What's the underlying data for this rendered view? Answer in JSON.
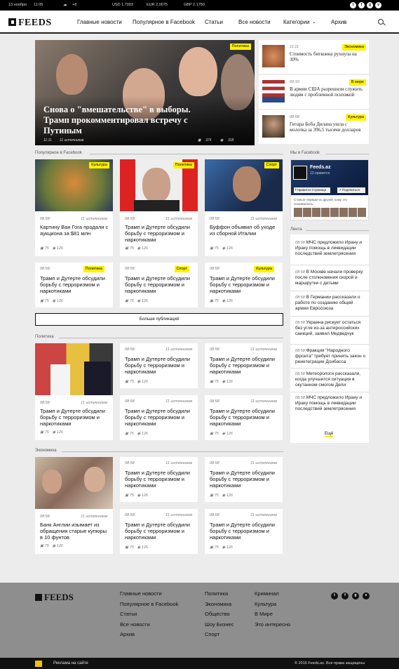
{
  "topbar": {
    "date": "13 ноября",
    "time": "11:05",
    "weather": "+8",
    "usd": "USD 1.7003",
    "eur": "EUR 2.0075",
    "gbp": "GBP 2.1750"
  },
  "social": [
    "twitter",
    "facebook",
    "google-plus",
    "vk"
  ],
  "logo": "FEEDS",
  "nav": [
    "Главные новости",
    "Популярное в Facebook",
    "Статьи",
    "Все новости",
    "Категории",
    "Архив"
  ],
  "hero": {
    "tag": "Политика",
    "title": "Снова о \"вмешательстве\" в выборы. Трамп прокомментировал встречу с Путиным",
    "time": "11:11",
    "sources": "11 источников",
    "comments": "374",
    "views": "318"
  },
  "side": [
    {
      "time": "11:11",
      "tag": "Экономика",
      "text": "Стоимость биткоина рухнула на 30%"
    },
    {
      "time": "09:10",
      "tag": "В мире",
      "text": "В армии США разрешили служить людям с проблемной психикой"
    },
    {
      "time": "08:58",
      "tag": "Культура",
      "text": "Гитара Боба Дилана ушла с молотка за 396,5 тысячи долларов"
    }
  ],
  "sections": {
    "popular": "Популярное в Facebook",
    "fb": "Мы в Facebook",
    "lenta": "Лента",
    "politics": "Политика",
    "economy": "Экономика"
  },
  "popular": [
    {
      "time": "08:58",
      "src": "11 источников",
      "tag": "Культура",
      "title": "Картину Ван Гога продали с аукциона за $81 млн",
      "c": "75",
      "v": "126"
    },
    {
      "time": "08:58",
      "src": "11 источников",
      "tag": "Политика",
      "title": "Трамп и Дутерте обсудили борьбу с терроризмом и наркотиками",
      "c": "75",
      "v": "126"
    },
    {
      "time": "08:58",
      "src": "11 источников",
      "tag": "Спорт",
      "title": "Буффон объявил об уходе из сборной Италии",
      "c": "75",
      "v": "126"
    },
    {
      "time": "08:58",
      "src": "",
      "tag": "Политика",
      "title": "Трамп и Дутерте обсудили борьбу с терроризмом и наркотиками",
      "c": "75",
      "v": "126"
    },
    {
      "time": "08:58",
      "src": "",
      "tag": "Спорт",
      "title": "Трамп и Дутерте обсудили борьбу с терроризмом и наркотиками",
      "c": "75",
      "v": "126"
    },
    {
      "time": "08:58",
      "src": "",
      "tag": "Культура",
      "title": "Трамп и Дутерте обсудили борьбу с терроризмом и наркотиками",
      "c": "75",
      "v": "126"
    }
  ],
  "more_label": "Больше публикаций",
  "politics": [
    {
      "time": "08:58",
      "src": "11 источников",
      "title": "Трамп и Дутерте обсудили борьбу с терроризмом и наркотиками",
      "c": "75",
      "v": "126"
    },
    {
      "time": "08:58",
      "src": "11 источников",
      "title": "Трамп и Дутерте обсудили борьбу с терроризмом и наркотиками",
      "c": "75",
      "v": "126"
    },
    {
      "time": "08:58",
      "src": "11 источников",
      "title": "Трамп и Дутерте обсудили борьбу с терроризмом и наркотиками",
      "c": "75",
      "v": "126"
    },
    {
      "time": "08:58",
      "src": "11 источников",
      "title": "Трамп и Дутерте обсудили борьбу с терроризмом и наркотиками",
      "c": "75",
      "v": "126"
    },
    {
      "time": "08:58",
      "src": "11 источников",
      "title": "Трамп и Дутерте обсудили борьбу с терроризмом и наркотиками",
      "c": "75",
      "v": "126"
    }
  ],
  "economy": [
    {
      "time": "08:58",
      "src": "11 источников",
      "title": "Банк Англии изымает из обращения старые купюры в 10 фунтов",
      "c": "75",
      "v": "126"
    },
    {
      "time": "08:58",
      "src": "11 источников",
      "title": "Трамп и Дутерте обсудили борьбу с терроризмом и наркотиками",
      "c": "75",
      "v": "126"
    },
    {
      "time": "08:58",
      "src": "11 источников",
      "title": "Трамп и Дутерте обсудили борьбу с терроризмом и наркотиками",
      "c": "75",
      "v": "126"
    },
    {
      "time": "08:58",
      "src": "11 источников",
      "title": "Трамп и Дутерте обсудили борьбу с терроризмом и наркотиками",
      "c": "75",
      "v": "126"
    },
    {
      "time": "08:58",
      "src": "11 источников",
      "title": "Трамп и Дутерте обсудили борьбу с терроризмом и наркотиками",
      "c": "75",
      "v": "126"
    }
  ],
  "fbwidget": {
    "name": "Feeds.az",
    "likes": "13 нравится",
    "like_btn": "Нравится Страница",
    "share_btn": "Поделиться",
    "friends": "Станьте первым из друзей, кому это понравилось."
  },
  "lenta": [
    {
      "time": "08:58",
      "text": "МЧС предложило Ирану и Ираку помощь в ликвидации последствий землетрясения"
    },
    {
      "time": "08:58",
      "text": "В Москве начали проверку после столкновения скорой и маршрутки с детьми"
    },
    {
      "time": "08:58",
      "text": "В Германии рассказали о работе по созданию общей армии Евросоюза"
    },
    {
      "time": "08:58",
      "text": "Украина рискует остаться без угля из-за антироссийских санкций, заявил Медведчук"
    },
    {
      "time": "08:58",
      "text": "Фракция \"Народного фронта\" требует принять закон о реинтеграции Донбасса"
    },
    {
      "time": "08:58",
      "text": "Метеорологи рассказали, когда улучшится ситуация в окутанном смогом Дели"
    },
    {
      "time": "08:58",
      "text": "МЧС предложило Ирану и Ираку помощь в ликвидации последствий землетрясения"
    }
  ],
  "lenta_more": "Ещё",
  "footer": {
    "col1": [
      "Главные новости",
      "Популярное в Facebook",
      "Статьи",
      "Все новости",
      "Архив"
    ],
    "col2": [
      "Политика",
      "Экономика",
      "Общество",
      "Шоу Бизнес",
      "Спорт"
    ],
    "col3": [
      "Криминал",
      "Культура",
      "В Мире",
      "Это интересно"
    ]
  },
  "bottom": {
    "ad": "Реклама на сайте",
    "copy": "© 2016 Feeds.az. Все права защищены"
  },
  "colors": {
    "tag": "#fff200",
    "footer": "#8e8e8e"
  }
}
